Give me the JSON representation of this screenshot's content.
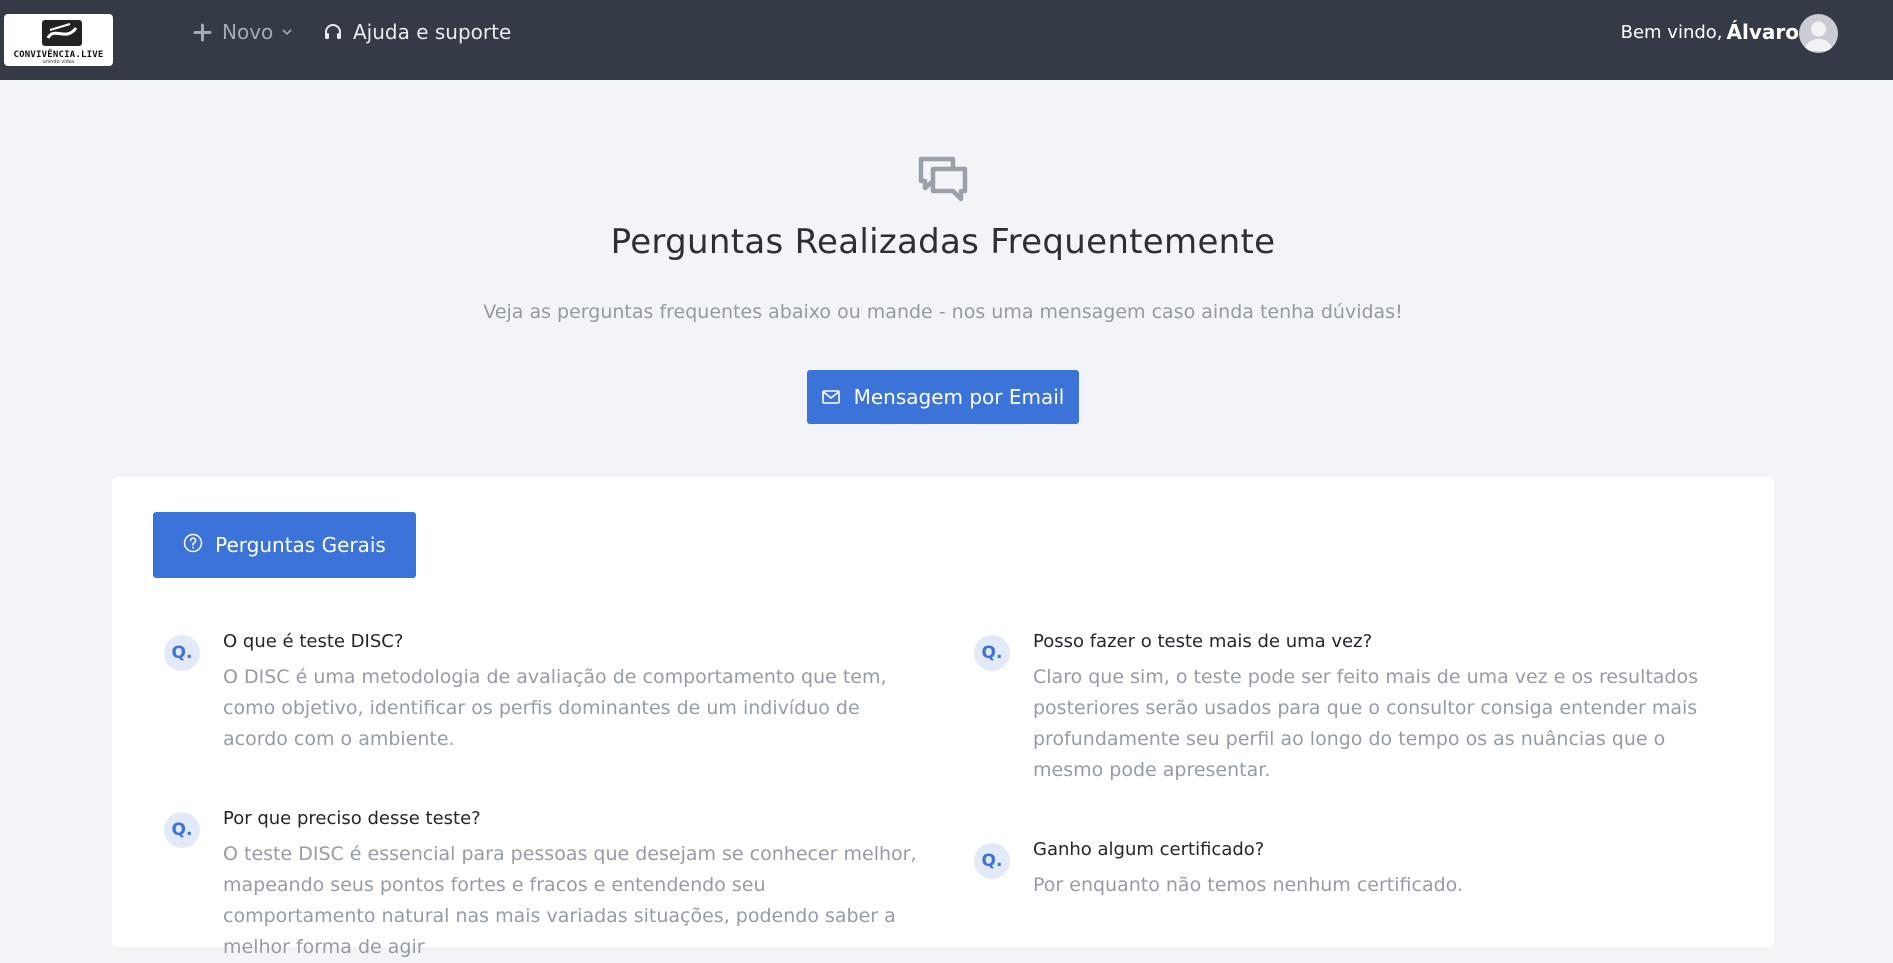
{
  "header": {
    "logo_text": "CONVIVÊNCIA.LIVE",
    "logo_subtext": "unindo vidas",
    "nav_new_label": "Novo",
    "nav_help_label": "Ajuda e suporte",
    "welcome_text": "Bem vindo,",
    "user_name": "Álvaro"
  },
  "hero": {
    "title": "Perguntas Realizadas Frequentemente",
    "subtitle": "Veja as perguntas frequentes abaixo ou mande - nos uma mensagem caso ainda tenha dúvidas!",
    "email_button_label": "Mensagem por Email"
  },
  "faq_section": {
    "category_label": "Perguntas Gerais",
    "q_marker": "Q.",
    "items": [
      {
        "question": "O que é teste DISC?",
        "answer": "O DISC é uma metodologia de avaliação de comportamento que tem, como objetivo, identificar os perfis dominantes de um indivíduo de acordo com o ambiente."
      },
      {
        "question": "Posso fazer o teste mais de uma vez?",
        "answer": "Claro que sim, o teste pode ser feito mais de uma vez e os resultados posteriores serão usados para que o consultor consiga entender mais profundamente seu perfil ao longo do tempo os as nuâncias que o mesmo pode apresentar."
      },
      {
        "question": "Por que preciso desse teste?",
        "answer": "O teste DISC é essencial para pessoas que desejam se conhecer melhor, mapeando seus pontos fortes e fracos e entendendo seu comportamento natural nas mais variadas situações, podendo saber a melhor forma de agir"
      },
      {
        "question": "Ganho algum certificado?",
        "answer": "Por enquanto não temos nenhum certificado."
      }
    ]
  },
  "colors": {
    "topbar": "#343a46",
    "primary": "#3b73d9",
    "page_bg": "#f3f4f7",
    "muted_text": "#959ca6"
  },
  "icons": [
    "plus-icon",
    "chevron-down-icon",
    "headset-icon",
    "chat-bubbles-icon",
    "mail-icon",
    "question-circle-icon",
    "user-avatar-icon"
  ]
}
